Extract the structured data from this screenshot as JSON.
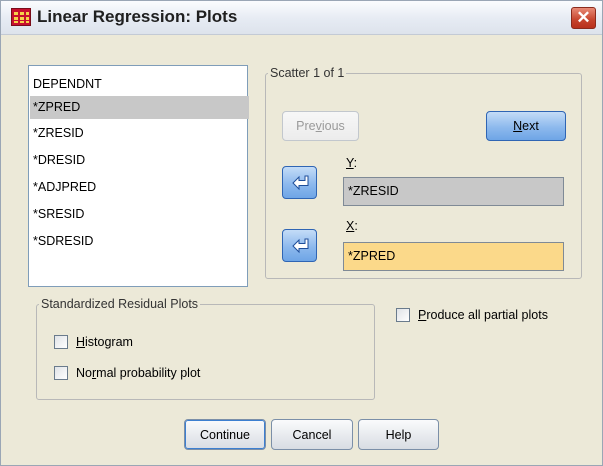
{
  "window": {
    "title": "Linear Regression: Plots",
    "close_glyph": "✕"
  },
  "variables": {
    "items": [
      "DEPENDNT",
      "*ZPRED",
      "*ZRESID",
      "*DRESID",
      "*ADJPRED",
      "*SRESID",
      "*SDRESID"
    ],
    "selected_index": 1
  },
  "scatter": {
    "legend": "Scatter 1 of 1",
    "previous_pre": "Pre",
    "previous_ul": "v",
    "previous_post": "ious",
    "next_ul": "N",
    "next_post": "ext",
    "y_label_ul": "Y",
    "y_label_post": ":",
    "y_value": "*ZRESID",
    "x_label_ul": "X",
    "x_label_post": ":",
    "x_value": "*ZPRED"
  },
  "residual_plots": {
    "legend": "Standardized Residual Plots",
    "histogram_ul": "H",
    "histogram_post": "istogram",
    "normal_pre": "No",
    "normal_ul": "r",
    "normal_post": "mal probability plot"
  },
  "partial": {
    "pre": "",
    "ul": "P",
    "post": "roduce all partial plots"
  },
  "buttons": {
    "continue": "Continue",
    "cancel": "Cancel",
    "help": "Help"
  },
  "colors": {
    "x_field": "#fbd98a",
    "y_field": "#c8c8c8",
    "selection": "#c8c8c8"
  }
}
